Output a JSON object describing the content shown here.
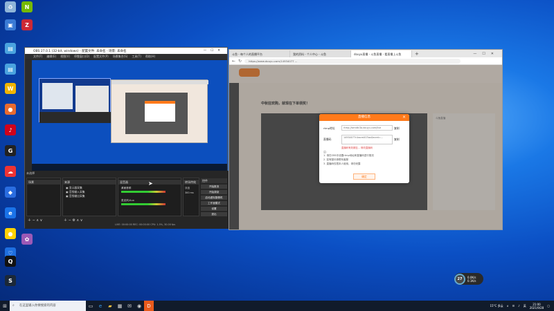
{
  "desktop": {
    "icons": [
      {
        "label": "",
        "name": "recycle-bin-icon",
        "color": "#8fb5d8",
        "glyph": "♻"
      },
      {
        "label": "",
        "name": "nvidia-icon",
        "color": "#76b900",
        "glyph": "N"
      },
      {
        "label": "",
        "name": "monitor-icon",
        "color": "#3a7bd5",
        "glyph": "▣"
      },
      {
        "label": "",
        "name": "zotero-icon",
        "color": "#cc2936",
        "glyph": "Z"
      },
      {
        "label": "",
        "name": "computer-icon",
        "color": "#4aa3df",
        "glyph": "▤"
      },
      {
        "label": "",
        "name": "network-icon",
        "color": "#4aa3df",
        "glyph": "▤"
      },
      {
        "label": "",
        "name": "wps-icon",
        "color": "#f0b400",
        "glyph": "W"
      },
      {
        "label": "",
        "name": "app-icon",
        "color": "#e96b2f",
        "glyph": "●"
      },
      {
        "label": "",
        "name": "netease-music-icon",
        "color": "#d0021b",
        "glyph": "♪"
      },
      {
        "label": "",
        "name": "gpu-z-icon",
        "color": "#222",
        "glyph": "G"
      },
      {
        "label": "",
        "name": "cloud-icon",
        "color": "#e33",
        "glyph": "☁"
      },
      {
        "label": "",
        "name": "baidu-icon",
        "color": "#2a6de0",
        "glyph": "◆"
      },
      {
        "label": "",
        "name": "browser-icon",
        "color": "#1a73e8",
        "glyph": "e"
      },
      {
        "label": "",
        "name": "app2-icon",
        "color": "#ffd200",
        "glyph": "●"
      },
      {
        "label": "",
        "name": "security-icon",
        "color": "#1e6fe0",
        "glyph": "♡"
      },
      {
        "label": "",
        "name": "app3-icon",
        "color": "#9b59b6",
        "glyph": "✿"
      },
      {
        "label": "",
        "name": "qq-icon",
        "color": "#111",
        "glyph": "Q"
      },
      {
        "label": "",
        "name": "steam-icon",
        "color": "#1b2838",
        "glyph": "S"
      }
    ]
  },
  "obs": {
    "title": "OBS 27.0.1 (32-bit, windows) - 配置文件: 未命名 - 场景: 未命名",
    "menu": [
      "文件(F)",
      "编辑(E)",
      "视图(V)",
      "停靠窗口(D)",
      "配置文件(P)",
      "场景集合(S)",
      "工具(T)",
      "帮助(H)"
    ],
    "docks": [
      "场景",
      "来源",
      "混音器",
      "转场特效",
      "控件"
    ],
    "sources": [
      "显示器采集",
      "音频输入采集",
      "音频输出采集"
    ],
    "mixer_tracks": [
      "桌面音频",
      "麦克风/Aux"
    ],
    "transition": {
      "type": "淡出",
      "duration_label": "时长",
      "duration": "300 ms"
    },
    "controls": [
      "开始推流",
      "开始录制",
      "启动虚拟摄像机",
      "工作室模式",
      "设置",
      "退出"
    ],
    "status": "LIVE: 00:00:00  REC: 00:00:00  CPU: 1.5%, 30.00 fps"
  },
  "browser": {
    "tabs": [
      "斗鱼 - 每个人的直播平台",
      "我的资料 - 个人中心 - 斗鱼",
      "douyu直播 - 斗鱼直播 - 看直播上斗鱼"
    ],
    "url": "https://www.douyu.com/14934077 ...",
    "site_banner": "中秋狂欢购，就现在下单领奖！",
    "dialog": {
      "title": "直播信息",
      "rtmp_label": "rtmp地址",
      "rtmp_value": "rtmp://sendtc3a.douyu.com/live",
      "code_label": "直播码",
      "code_value": "14934077rUwcmIIO?wsSecret=...",
      "copy": "复制",
      "warning": "直播码有效期至...   修改直播码",
      "notes_title": "注：",
      "notes": [
        "1. 请在OBS中设置rtmp地址和直播码进行推流",
        "2. 如有疑问请联系客服",
        "3. 直播码仅限本人使用，请勿泄露"
      ],
      "ok": "确定"
    },
    "side_text": "斗鱼直播"
  },
  "taskbar": {
    "search_placeholder": "在这里输入你要搜索的内容",
    "weather": "15°C 多云",
    "lang": "英",
    "time": "21:00",
    "date": "2021/9/28"
  },
  "netmon": {
    "percent": "27",
    "unit": "%",
    "up": "0.0K/s",
    "down": "0.1K/s"
  }
}
